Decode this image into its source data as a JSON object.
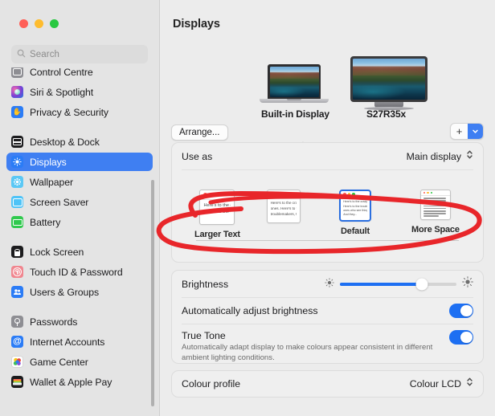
{
  "window": {
    "traffic_lights": [
      "close",
      "minimize",
      "maximize"
    ],
    "colors": {
      "accent": "#3f7ff2",
      "slider_blue": "#1d6ff2",
      "toggle_on": "#1d6ff2",
      "selected_border": "#2b6fe0",
      "annotation_red": "#e8262a",
      "sidebar_bg": "#e4e4e4",
      "content_bg": "#ececec",
      "card_bg": "#efefef"
    }
  },
  "search": {
    "placeholder": "Search",
    "value": "",
    "icon": "search-icon"
  },
  "sidebar": {
    "groups": [
      {
        "items": [
          {
            "label": "Control Centre",
            "icon": "control-centre-icon",
            "icon_class": "ic-control",
            "active": false
          },
          {
            "label": "Siri & Spotlight",
            "icon": "siri-icon",
            "icon_class": "ic-siri",
            "active": false
          },
          {
            "label": "Privacy & Security",
            "icon": "privacy-icon",
            "icon_class": "ic-privacy",
            "active": false
          }
        ]
      },
      {
        "items": [
          {
            "label": "Desktop & Dock",
            "icon": "desktop-dock-icon",
            "icon_class": "ic-desktop",
            "active": false
          },
          {
            "label": "Displays",
            "icon": "displays-icon",
            "icon_class": "ic-displays",
            "active": true
          },
          {
            "label": "Wallpaper",
            "icon": "wallpaper-icon",
            "icon_class": "ic-wallpaper",
            "active": false
          },
          {
            "label": "Screen Saver",
            "icon": "screen-saver-icon",
            "icon_class": "ic-screensaver",
            "active": false
          },
          {
            "label": "Battery",
            "icon": "battery-icon",
            "icon_class": "ic-battery",
            "active": false
          }
        ]
      },
      {
        "items": [
          {
            "label": "Lock Screen",
            "icon": "lock-screen-icon",
            "icon_class": "ic-lock",
            "active": false
          },
          {
            "label": "Touch ID & Password",
            "icon": "touch-id-icon",
            "icon_class": "ic-touchid",
            "active": false
          },
          {
            "label": "Users & Groups",
            "icon": "users-groups-icon",
            "icon_class": "ic-users",
            "active": false
          }
        ]
      },
      {
        "items": [
          {
            "label": "Passwords",
            "icon": "passwords-icon",
            "icon_class": "ic-passwords",
            "active": false
          },
          {
            "label": "Internet Accounts",
            "icon": "internet-accounts-icon",
            "icon_class": "ic-internet",
            "active": false
          },
          {
            "label": "Game Center",
            "icon": "game-center-icon",
            "icon_class": "ic-gamecenter",
            "active": false
          },
          {
            "label": "Wallet & Apple Pay",
            "icon": "wallet-icon",
            "icon_class": "ic-wallet",
            "active": false
          }
        ]
      }
    ]
  },
  "main": {
    "title": "Displays",
    "arrange_button": "Arrange...",
    "displays": [
      {
        "name": "Built-in Display",
        "type": "laptop",
        "selected": true
      },
      {
        "name": "S27R35x",
        "type": "monitor",
        "selected": false
      }
    ],
    "add_display": {
      "plus_label": "+",
      "chevron_icon": "chevron-down-icon"
    },
    "use_as": {
      "label": "Use as",
      "value": "Main display",
      "stepper_icon": "up-down-chevron-icon"
    },
    "scaling": {
      "options": [
        {
          "label": "Larger Text",
          "selected": false,
          "preview_text": "Here's to the crazy ones. Here's to the troublemakers."
        },
        {
          "label": "",
          "selected": false,
          "preview_text": "Here's to the crazy ones. Here's to the troublemakers, the ones who..."
        },
        {
          "label": "Default",
          "selected": true,
          "preview_text": "Here's to the crazy ones. Here's to the troublemakers, the ones who see things differently. And they..."
        },
        {
          "label": "More Space",
          "selected": false,
          "preview_text": "Here's to the crazy ones. Here's to the troublemakers. The ones who see things differently. And they have no rules. And they have no respect for the status quo. About the only thing you can do is ignore them. Because they change things."
        }
      ]
    },
    "brightness": {
      "label": "Brightness",
      "value_percent": 70,
      "low_icon": "brightness-low-icon",
      "high_icon": "brightness-high-icon"
    },
    "auto_brightness": {
      "label": "Automatically adjust brightness",
      "enabled": true
    },
    "true_tone": {
      "label": "True Tone",
      "description": "Automatically adapt display to make colours appear consistent in different ambient lighting conditions.",
      "enabled": true
    },
    "colour_profile": {
      "label": "Colour profile",
      "value": "Colour LCD",
      "stepper_icon": "up-down-chevron-icon"
    }
  },
  "annotation": {
    "type": "hand-drawn-ellipse",
    "colour": "#e8262a",
    "target": "scaling resolution options row"
  }
}
